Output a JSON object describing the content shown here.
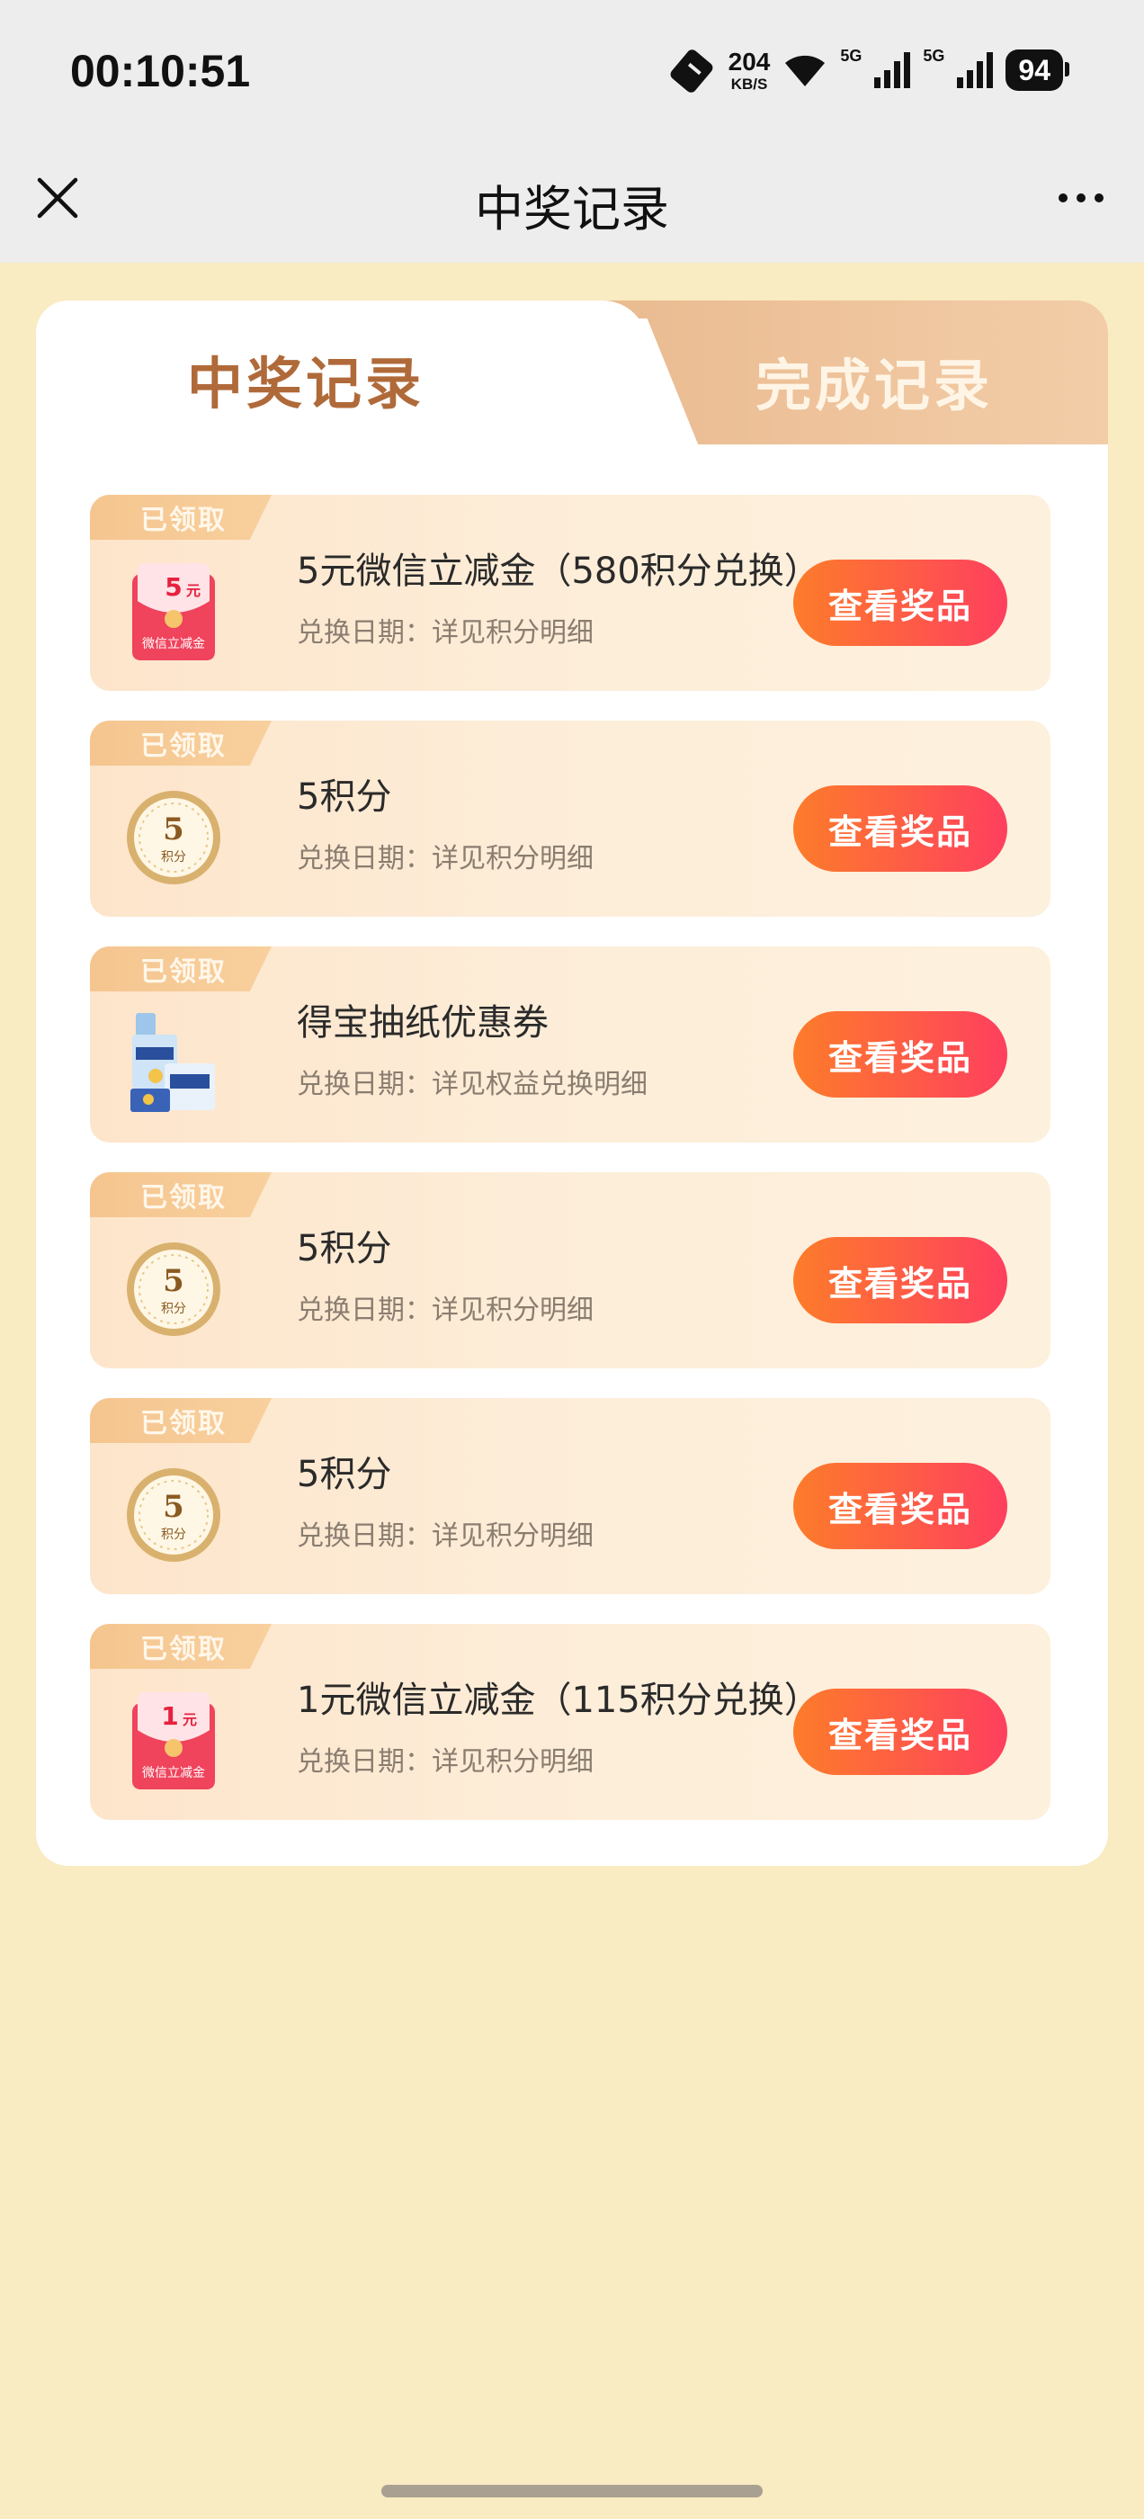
{
  "status_bar": {
    "time": "00:10:51",
    "net_speed_value": "204",
    "net_speed_unit": "KB/S",
    "signal1_label": "5G",
    "signal2_label": "5G",
    "battery": "94"
  },
  "nav": {
    "title": "中奖记录",
    "close_icon": "close-icon",
    "more_icon": "more-dots-icon"
  },
  "tabs": [
    {
      "label": "中奖记录",
      "active": true
    },
    {
      "label": "完成记录",
      "active": false
    }
  ],
  "records": [
    {
      "badge": "已领取",
      "title": "5元微信立减金（580积分兑换）",
      "subtitle": "兑换日期：详见积分明细",
      "button": "查看奖品",
      "icon": "red-envelope-icon",
      "icon_amount": "5",
      "icon_unit": "元",
      "icon_caption": "微信立减金"
    },
    {
      "badge": "已领取",
      "title": "5积分",
      "subtitle": "兑换日期：详见积分明细",
      "button": "查看奖品",
      "icon": "points-coin-icon",
      "icon_amount": "5",
      "icon_caption": "积分"
    },
    {
      "badge": "已领取",
      "title": "得宝抽纸优惠券",
      "subtitle": "兑换日期：详见权益兑换明细",
      "button": "查看奖品",
      "icon": "tissue-pack-icon"
    },
    {
      "badge": "已领取",
      "title": "5积分",
      "subtitle": "兑换日期：详见积分明细",
      "button": "查看奖品",
      "icon": "points-coin-icon",
      "icon_amount": "5",
      "icon_caption": "积分"
    },
    {
      "badge": "已领取",
      "title": "5积分",
      "subtitle": "兑换日期：详见积分明细",
      "button": "查看奖品",
      "icon": "points-coin-icon",
      "icon_amount": "5",
      "icon_caption": "积分"
    },
    {
      "badge": "已领取",
      "title": "1元微信立减金（115积分兑换）",
      "subtitle": "兑换日期：详见积分明细",
      "button": "查看奖品",
      "icon": "red-envelope-icon",
      "icon_amount": "1",
      "icon_unit": "元",
      "icon_caption": "微信立减金"
    }
  ],
  "colors": {
    "page_bg": "#f9ebc2",
    "button_start": "#fd7c2a",
    "button_end": "#fe3f5e",
    "tab_active_text": "#b06a3a"
  }
}
